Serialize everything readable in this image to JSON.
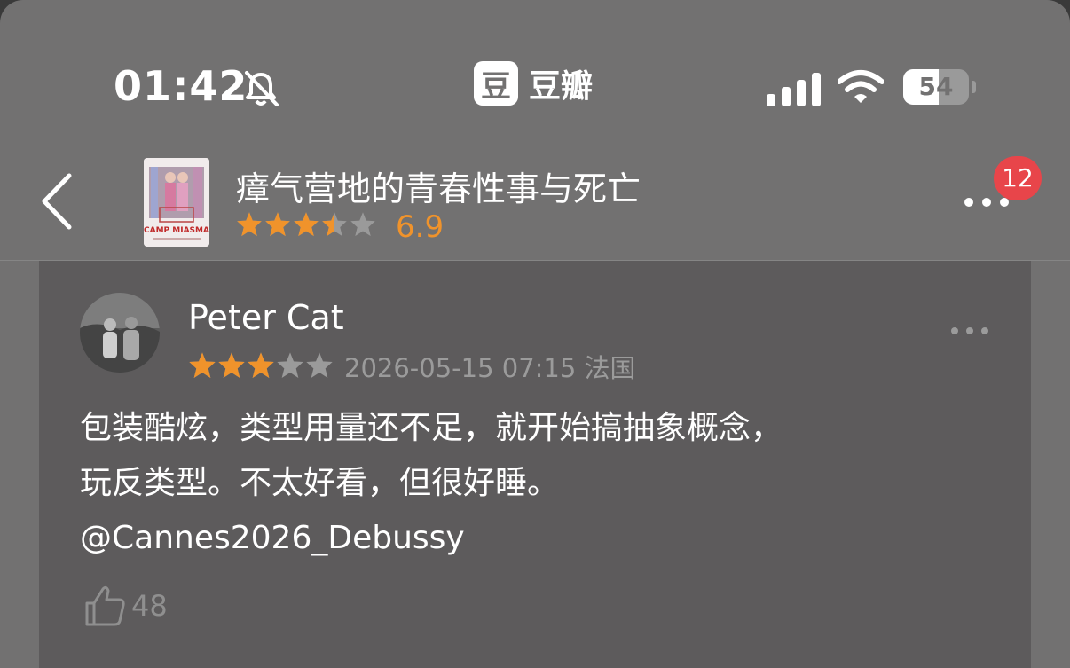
{
  "status_bar": {
    "time": "01:42",
    "battery": "54",
    "battery_level": 0.54
  },
  "app": {
    "logo_glyph": "豆",
    "name": "豆瓣"
  },
  "header": {
    "back_icon": "chevron-left-icon",
    "poster_text": "CAMP MIASMA",
    "title": "瘴气营地的青春性事与死亡",
    "stars": 3.5,
    "rating": "6.9",
    "more_icon": "ellipsis-icon",
    "notification_count": "12"
  },
  "review": {
    "user_name": "Peter Cat",
    "stars": 3,
    "datetime": "2026-05-15 07:15",
    "location": "法国",
    "lines": [
      "包装酷炫，类型用量还不足，就开始搞抽象概念，",
      "玩反类型。不太好看，但很好睡。",
      "@Cannes2026_Debussy"
    ],
    "likes": "48"
  },
  "colors": {
    "background": "#727171",
    "card": "#5d5b5c",
    "star_filled": "#f0932b",
    "star_empty": "#9a9a9a",
    "badge": "#e8454a"
  }
}
